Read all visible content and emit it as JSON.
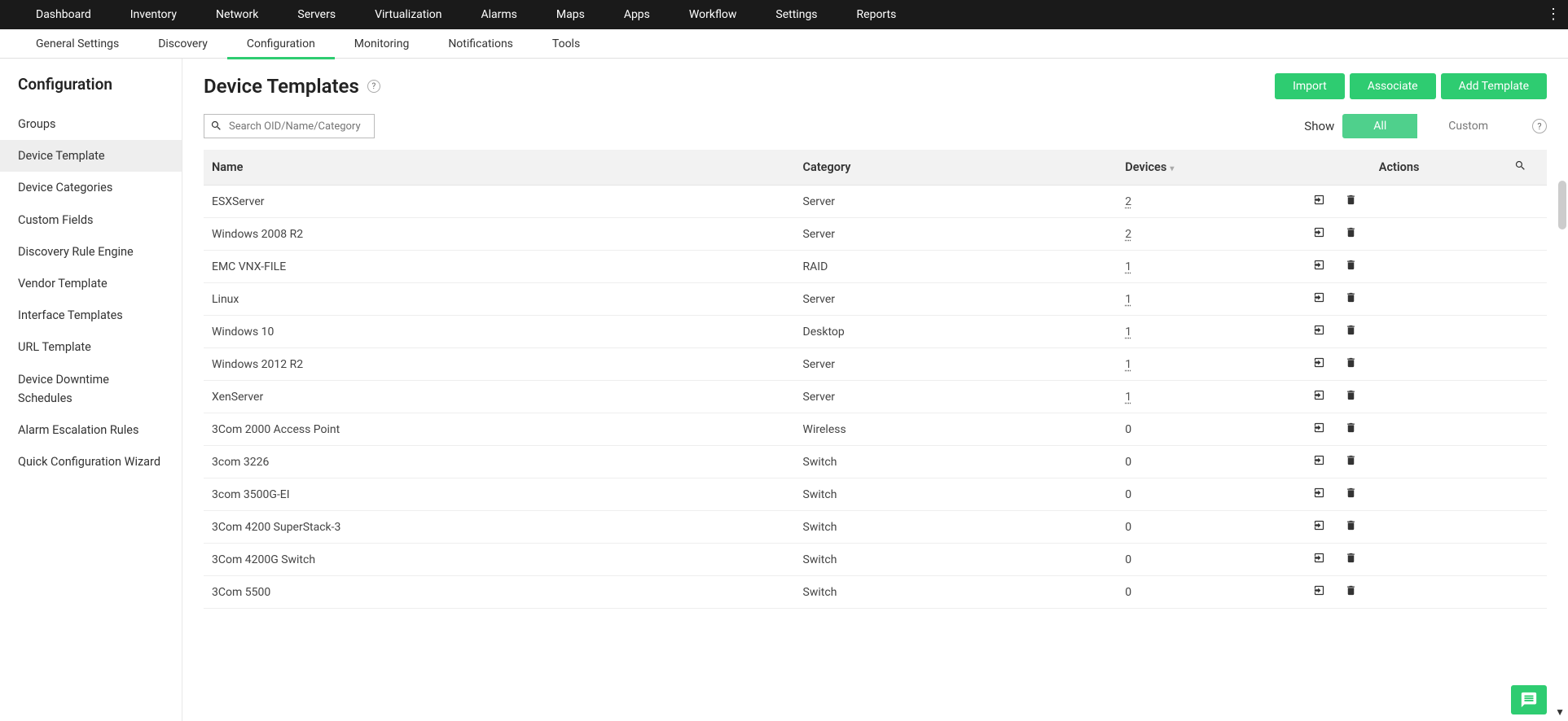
{
  "topnav": [
    "Dashboard",
    "Inventory",
    "Network",
    "Servers",
    "Virtualization",
    "Alarms",
    "Maps",
    "Apps",
    "Workflow",
    "Settings",
    "Reports"
  ],
  "subnav": {
    "items": [
      "General Settings",
      "Discovery",
      "Configuration",
      "Monitoring",
      "Notifications",
      "Tools"
    ],
    "active": 2
  },
  "sidebar": {
    "title": "Configuration",
    "items": [
      "Groups",
      "Device Template",
      "Device Categories",
      "Custom Fields",
      "Discovery Rule Engine",
      "Vendor Template",
      "Interface Templates",
      "URL Template",
      "Device Downtime Schedules",
      "Alarm Escalation Rules",
      "Quick Configuration Wizard"
    ],
    "active": 1
  },
  "page": {
    "title": "Device Templates",
    "buttons": {
      "import": "Import",
      "associate": "Associate",
      "add": "Add Template"
    }
  },
  "search": {
    "placeholder": "Search OID/Name/Category"
  },
  "show": {
    "label": "Show",
    "all": "All",
    "custom": "Custom"
  },
  "table": {
    "headers": {
      "name": "Name",
      "category": "Category",
      "devices": "Devices",
      "actions": "Actions"
    },
    "rows": [
      {
        "name": "ESXServer",
        "category": "Server",
        "devices": "2",
        "underline": true
      },
      {
        "name": "Windows 2008 R2",
        "category": "Server",
        "devices": "2",
        "underline": true
      },
      {
        "name": "EMC VNX-FILE",
        "category": "RAID",
        "devices": "1",
        "underline": true
      },
      {
        "name": "Linux",
        "category": "Server",
        "devices": "1",
        "underline": true
      },
      {
        "name": "Windows 10",
        "category": "Desktop",
        "devices": "1",
        "underline": true
      },
      {
        "name": "Windows 2012 R2",
        "category": "Server",
        "devices": "1",
        "underline": true
      },
      {
        "name": "XenServer",
        "category": "Server",
        "devices": "1",
        "underline": true
      },
      {
        "name": "3Com 2000 Access Point",
        "category": "Wireless",
        "devices": "0",
        "underline": false
      },
      {
        "name": "3com 3226",
        "category": "Switch",
        "devices": "0",
        "underline": false
      },
      {
        "name": "3com 3500G-EI",
        "category": "Switch",
        "devices": "0",
        "underline": false
      },
      {
        "name": "3Com 4200 SuperStack-3",
        "category": "Switch",
        "devices": "0",
        "underline": false
      },
      {
        "name": "3Com 4200G Switch",
        "category": "Switch",
        "devices": "0",
        "underline": false
      },
      {
        "name": "3Com 5500",
        "category": "Switch",
        "devices": "0",
        "underline": false
      }
    ]
  }
}
